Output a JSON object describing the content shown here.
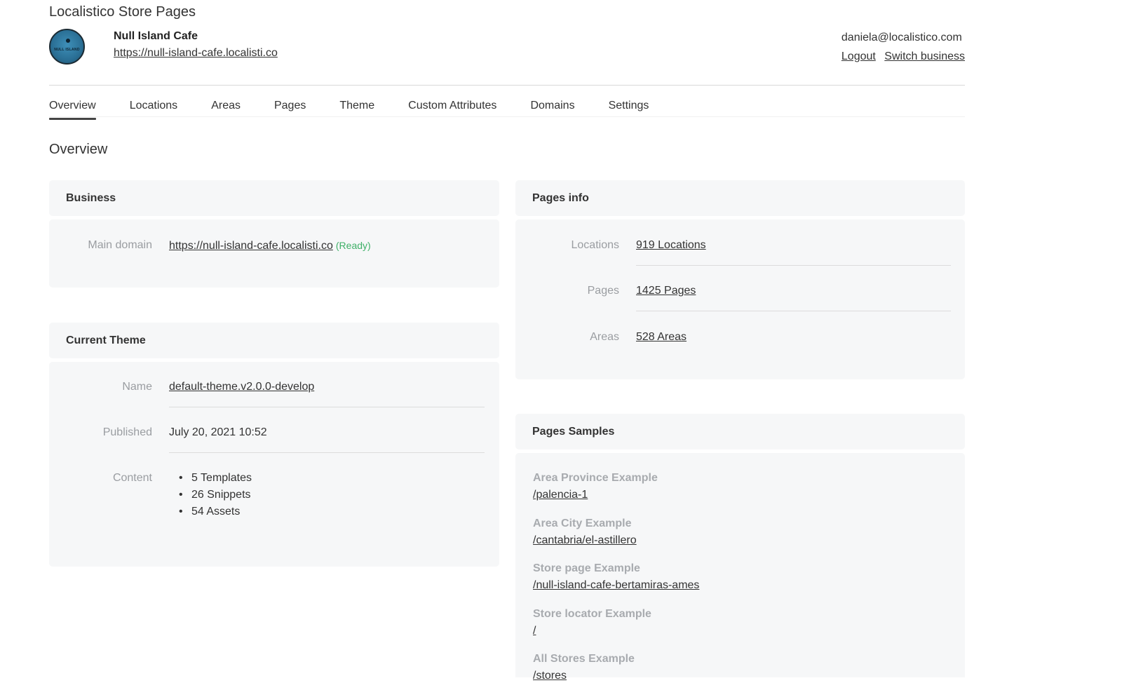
{
  "app": {
    "title": "Localistico Store Pages"
  },
  "business": {
    "name": "Null Island Cafe",
    "url": "https://null-island-cafe.localisti.co",
    "logo_text": "NULL ISLAND"
  },
  "account": {
    "email": "daniela@localistico.com",
    "logout_label": "Logout",
    "switch_label": "Switch business"
  },
  "tabs": [
    {
      "label": "Overview",
      "active": true
    },
    {
      "label": "Locations"
    },
    {
      "label": "Areas"
    },
    {
      "label": "Pages"
    },
    {
      "label": "Theme"
    },
    {
      "label": "Custom Attributes"
    },
    {
      "label": "Domains"
    },
    {
      "label": "Settings"
    }
  ],
  "page_title": "Overview",
  "business_card": {
    "title": "Business",
    "main_domain_label": "Main domain",
    "main_domain": "https://null-island-cafe.localisti.co",
    "main_domain_status": "(Ready)"
  },
  "theme_card": {
    "title": "Current Theme",
    "name_label": "Name",
    "name": "default-theme.v2.0.0-develop",
    "published_label": "Published",
    "published": "July 20, 2021 10:52",
    "content_label": "Content",
    "content": [
      "5 Templates",
      "26 Snippets",
      "54 Assets"
    ]
  },
  "pages_info": {
    "title": "Pages info",
    "locations_label": "Locations",
    "locations": "919 Locations",
    "pages_label": "Pages",
    "pages": "1425 Pages",
    "areas_label": "Areas",
    "areas": "528 Areas"
  },
  "samples": {
    "title": "Pages Samples",
    "items": [
      {
        "label": "Area Province Example",
        "path": "/palencia-1"
      },
      {
        "label": "Area City Example",
        "path": "/cantabria/el-astillero"
      },
      {
        "label": "Store page Example",
        "path": "/null-island-cafe-bertamiras-ames"
      },
      {
        "label": "Store locator Example",
        "path": "/"
      },
      {
        "label": "All Stores Example",
        "path": "/stores"
      }
    ]
  },
  "colors": {
    "card_bg": "#f6f7f8",
    "muted_label": "#9a9da1",
    "ready_green": "#3fb068",
    "sample_label": "#a8abaf"
  }
}
